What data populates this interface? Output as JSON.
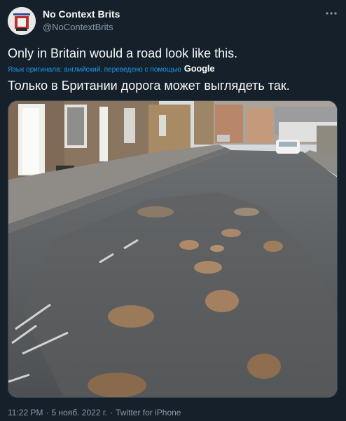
{
  "author": {
    "display_name": "No Context Brits",
    "handle": "@NoContextBrits"
  },
  "tweet": {
    "text": "Only in Britain would a road look like this.",
    "translation_note": "Язык оригинала: английский, переведено с помощью",
    "translation_provider": "Google",
    "translated_text": "Только в Британии дорога может выглядеть так."
  },
  "meta": {
    "time": "11:22 PM",
    "separator": "·",
    "date": "5 нояб. 2022 г.",
    "source": "Twitter for iPhone"
  },
  "icons": {
    "more": "more-horizontal-icon"
  },
  "colors": {
    "background": "#15202b",
    "primary_text": "#f7f9f9",
    "secondary_text": "#8b98a5",
    "link": "#1d9bf0"
  }
}
